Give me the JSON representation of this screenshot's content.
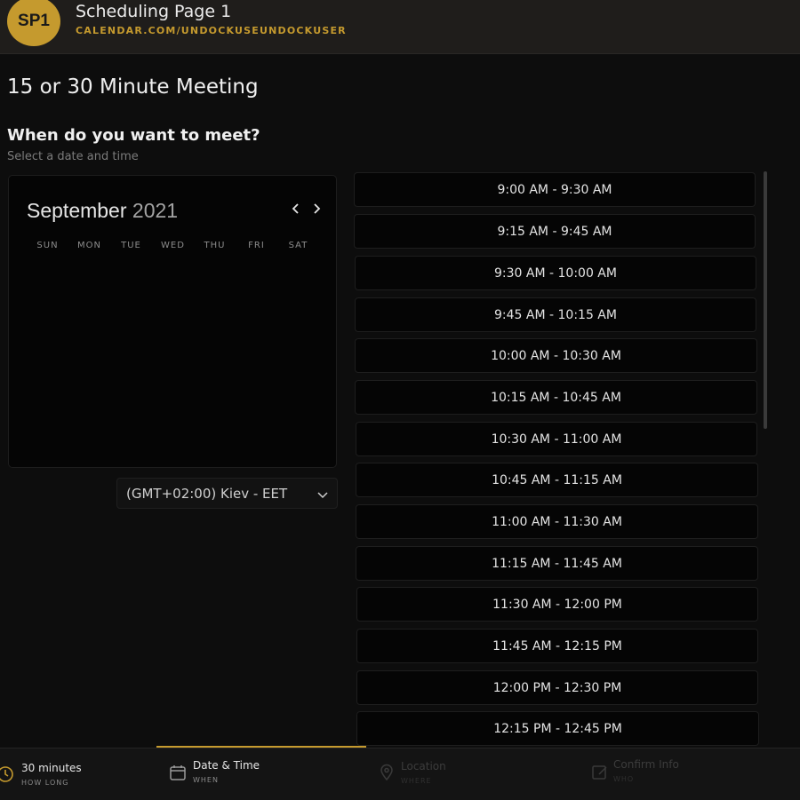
{
  "header": {
    "avatar_initials": "SP1",
    "title": "Scheduling Page 1",
    "url": "CALENDAR.COM/UNDOCKUSEUNDOCKUSER"
  },
  "page": {
    "title": "15 or 30 Minute Meeting",
    "question": "When do you want to meet?",
    "subtext": "Select a date and time"
  },
  "calendar": {
    "month": "September",
    "year": "2021",
    "prev_icon": "chevron-left-icon",
    "next_icon": "chevron-right-icon",
    "weekdays": [
      "SUN",
      "MON",
      "TUE",
      "WED",
      "THU",
      "FRI",
      "SAT"
    ]
  },
  "timezone": {
    "value": "(GMT+02:00) Kiev - EET"
  },
  "time_slots": [
    "9:00 AM - 9:30 AM",
    "9:15 AM - 9:45 AM",
    "9:30 AM - 10:00 AM",
    "9:45 AM - 10:15 AM",
    "10:00 AM - 10:30 AM",
    "10:15 AM - 10:45 AM",
    "10:30 AM - 11:00 AM",
    "10:45 AM - 11:15 AM",
    "11:00 AM - 11:30 AM",
    "11:15 AM - 11:45 AM",
    "11:30 AM - 12:00 PM",
    "11:45 AM - 12:15 PM",
    "12:00 PM - 12:30 PM",
    "12:15 PM - 12:45 PM"
  ],
  "steps": [
    {
      "label": "30 minutes",
      "sub": "HOW LONG",
      "icon": "clock-icon",
      "state": "active"
    },
    {
      "label": "Date & Time",
      "sub": "WHEN",
      "icon": "calendar-icon",
      "state": "active"
    },
    {
      "label": "Location",
      "sub": "WHERE",
      "icon": "location-pin-icon",
      "state": "inactive"
    },
    {
      "label": "Confirm Info",
      "sub": "WHO",
      "icon": "edit-icon",
      "state": "inactive"
    }
  ],
  "colors": {
    "accent": "#c59a2e",
    "background": "#0d0d0d"
  }
}
